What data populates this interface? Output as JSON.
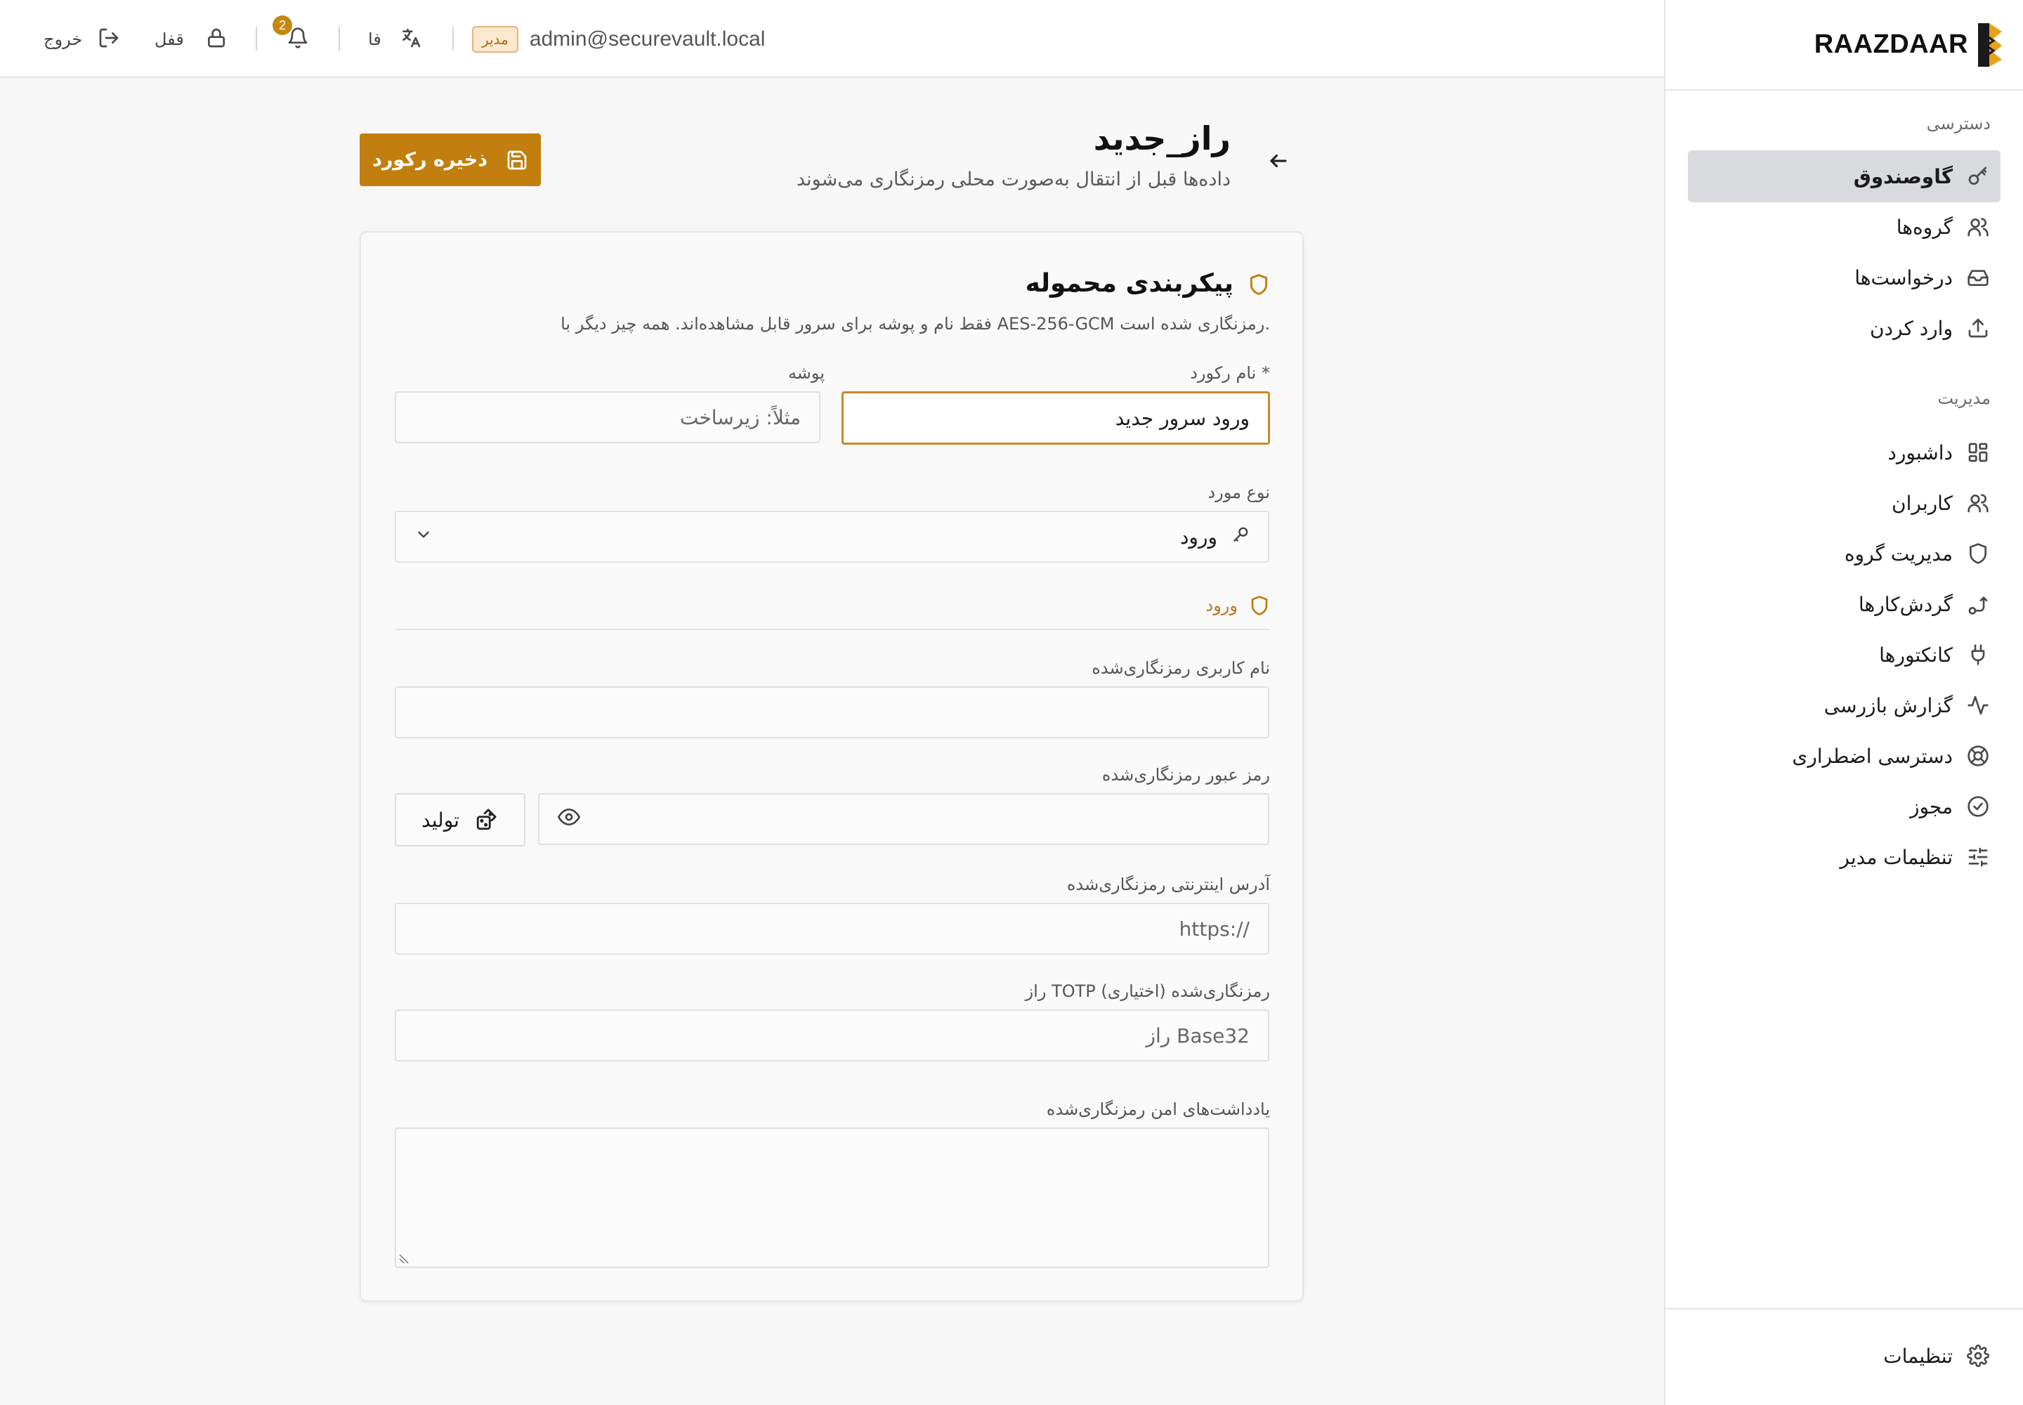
{
  "app": {
    "brand": "RAAZDAAR",
    "colors": {
      "accent": "#c27e0e",
      "active_nav_bg": "#d9dadd",
      "badge_bg": "#fbe8cf"
    }
  },
  "topbar": {
    "logout_label": "خروج",
    "lock_label": "قفل",
    "notification_count": "2",
    "language_label": "فا",
    "role_badge": "مدیر",
    "user_email": "admin@securevault.local"
  },
  "sidebar": {
    "access_section_title": "دسترسی",
    "access_items": [
      {
        "label": "گاوصندوق",
        "icon": "key-icon",
        "active": true
      },
      {
        "label": "گروه‌ها",
        "icon": "users-icon"
      },
      {
        "label": "درخواست‌ها",
        "icon": "inbox-icon"
      },
      {
        "label": "وارد کردن",
        "icon": "upload-icon"
      }
    ],
    "admin_section_title": "مدیریت",
    "admin_items": [
      {
        "label": "داشبورد",
        "icon": "dashboard-icon"
      },
      {
        "label": "کاربران",
        "icon": "users-icon"
      },
      {
        "label": "مدیریت گروه",
        "icon": "shield-icon"
      },
      {
        "label": "گردش‌کارها",
        "icon": "workflow-icon"
      },
      {
        "label": "کانکتورها",
        "icon": "plug-icon"
      },
      {
        "label": "گزارش بازرسی",
        "icon": "activity-icon"
      },
      {
        "label": "دسترسی اضطراری",
        "icon": "lifebuoy-icon"
      },
      {
        "label": "مجوز",
        "icon": "badge-check-icon"
      },
      {
        "label": "تنظیمات مدیر",
        "icon": "sliders-icon"
      }
    ],
    "settings_label": "تنظیمات"
  },
  "header": {
    "title": "راز_جدید",
    "subtitle": "داده‌ها قبل از انتقال به‌صورت محلی رمزنگاری می‌شوند",
    "save_label": "ذخیره رکورد"
  },
  "card": {
    "title": "پیکربندی محموله",
    "description": "فقط نام و پوشه برای سرور قابل مشاهده‌اند. همه چیز دیگر با AES-256-GCM رمزنگاری شده است.",
    "record_name": {
      "label": "نام رکورد *",
      "value": "ورود سرور جدید"
    },
    "folder": {
      "label": "پوشه",
      "placeholder": "مثلاً: زیرساخت"
    },
    "item_type": {
      "label": "نوع مورد",
      "value": "ورود"
    },
    "section_label": "ورود",
    "username": {
      "label": "نام کاربری رمزنگاری‌شده",
      "value": ""
    },
    "password": {
      "label": "رمز عبور رمزنگاری‌شده",
      "value": "",
      "generate_label": "تولید"
    },
    "url": {
      "label": "آدرس اینترنتی رمزنگاری‌شده",
      "placeholder": "https://"
    },
    "totp": {
      "label": "راز TOTP رمزنگاری‌شده (اختیاری)",
      "placeholder": "راز Base32"
    },
    "notes": {
      "label": "یادداشت‌های امن رمزنگاری‌شده"
    }
  }
}
